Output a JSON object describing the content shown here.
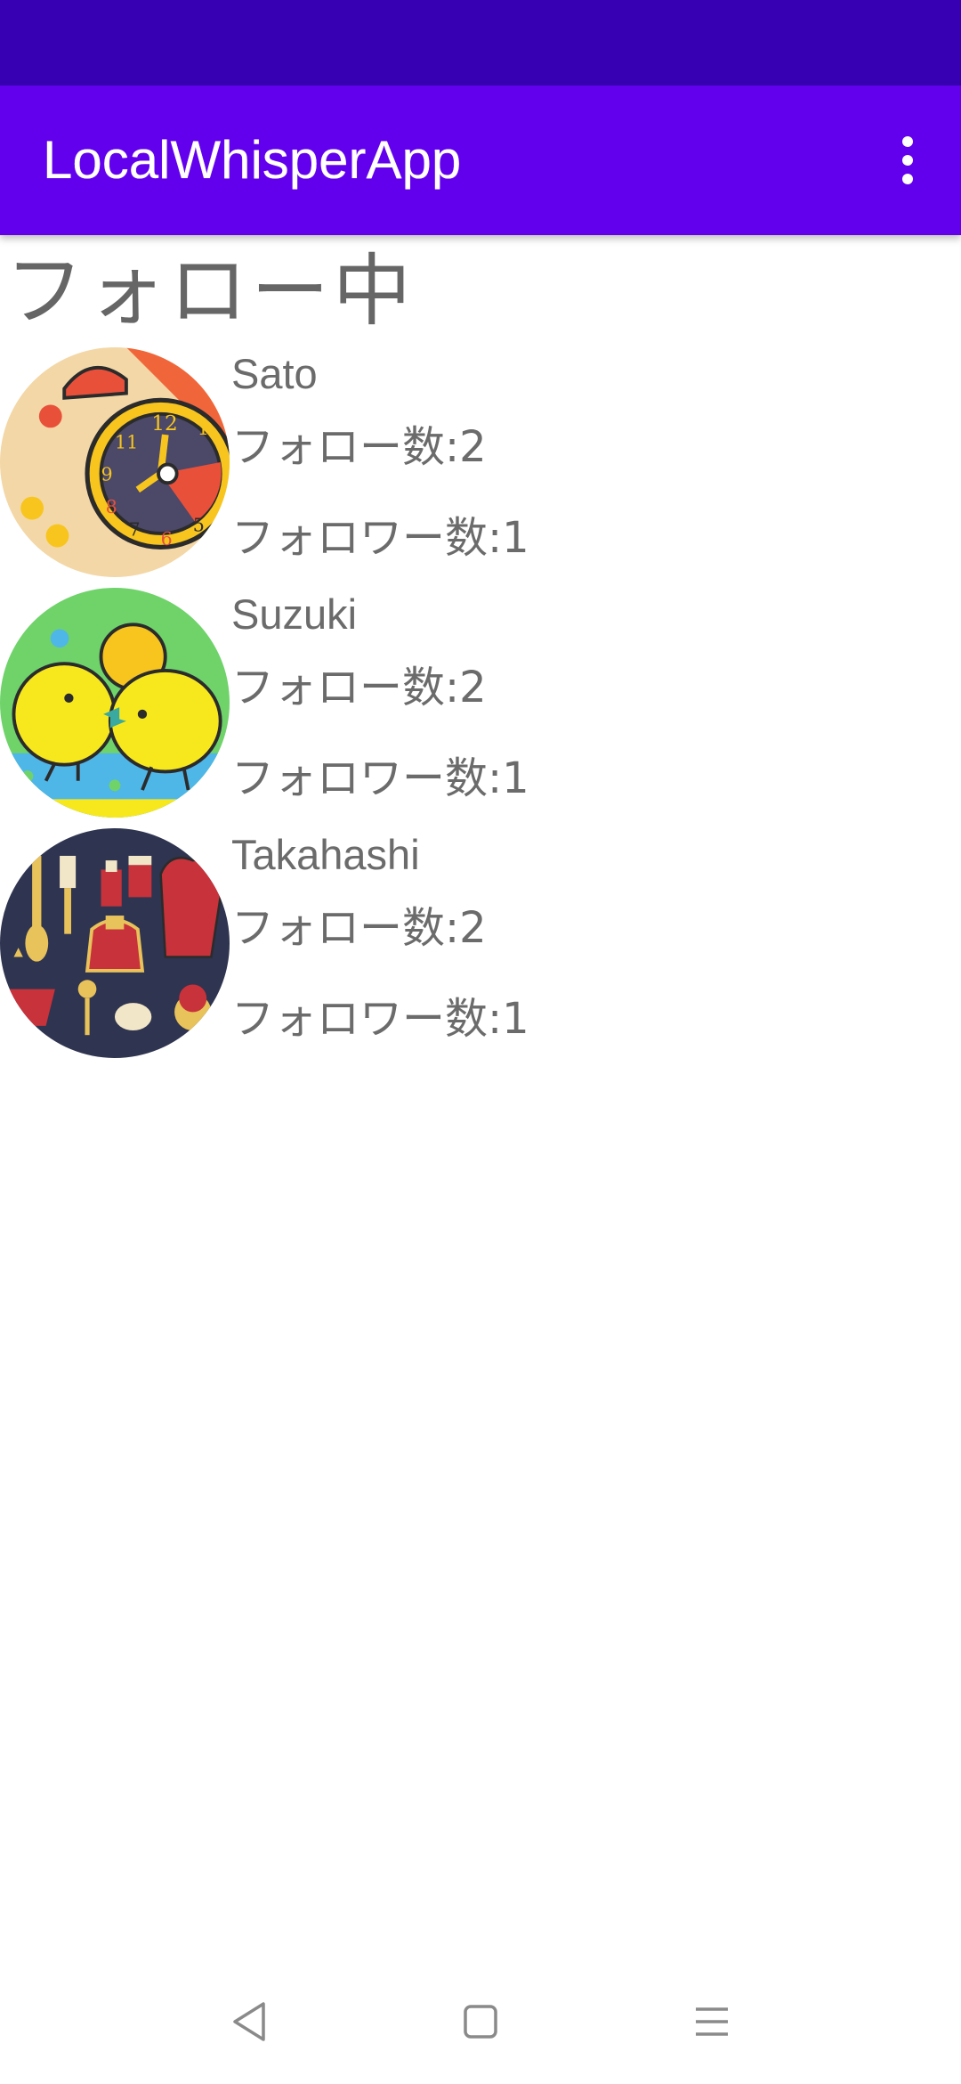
{
  "app_bar": {
    "title": "LocalWhisperApp",
    "menu_icon": "more-vert-icon"
  },
  "colors": {
    "status_bar": "#3700B3",
    "app_bar": "#6200EE",
    "text_secondary": "#6b6b6b"
  },
  "page": {
    "title": "フォロー中"
  },
  "users": [
    {
      "name": "Sato",
      "follow_count": "フォロー数:2",
      "follower_count": "フォロワー数:1",
      "avatar": "alarm-clock-avatar"
    },
    {
      "name": "Suzuki",
      "follow_count": "フォロー数:2",
      "follower_count": "フォロワー数:1",
      "avatar": "chicks-avatar"
    },
    {
      "name": "Takahashi",
      "follow_count": "フォロー数:2",
      "follower_count": "フォロワー数:1",
      "avatar": "kitchen-items-avatar"
    }
  ],
  "nav": {
    "back_icon": "back-triangle-icon",
    "home_icon": "home-square-icon",
    "recents_icon": "recents-menu-icon"
  }
}
